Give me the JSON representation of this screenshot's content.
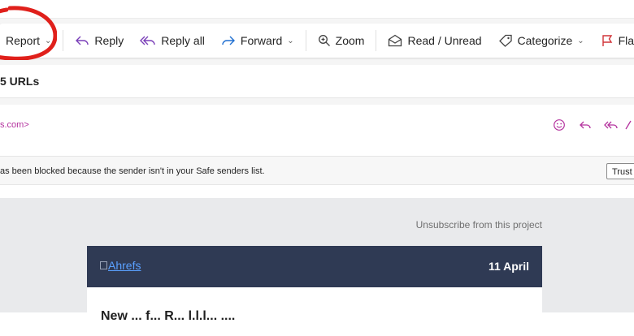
{
  "toolbar": {
    "report_label": "Report",
    "reply_label": "Reply",
    "reply_all_label": "Reply all",
    "forward_label": "Forward",
    "zoom_label": "Zoom",
    "read_unread_label": "Read / Unread",
    "categorize_label": "Categorize",
    "flag_label": "Flag"
  },
  "message": {
    "subject": "5 URLs",
    "sender_fragment": "s.com>",
    "warning_text": "as been blocked because the sender isn't in your Safe senders list.",
    "trust_button_label": "Trust"
  },
  "email_body": {
    "unsubscribe_text": "Unsubscribe from this project",
    "logo_alt": "Ahrefs",
    "date": "11 April",
    "headline": "New ... f... R... l.l.l... ...."
  },
  "colors": {
    "accent": "#b4329e",
    "brand_header": "#2f3a54",
    "annotation": "#e0201b"
  }
}
